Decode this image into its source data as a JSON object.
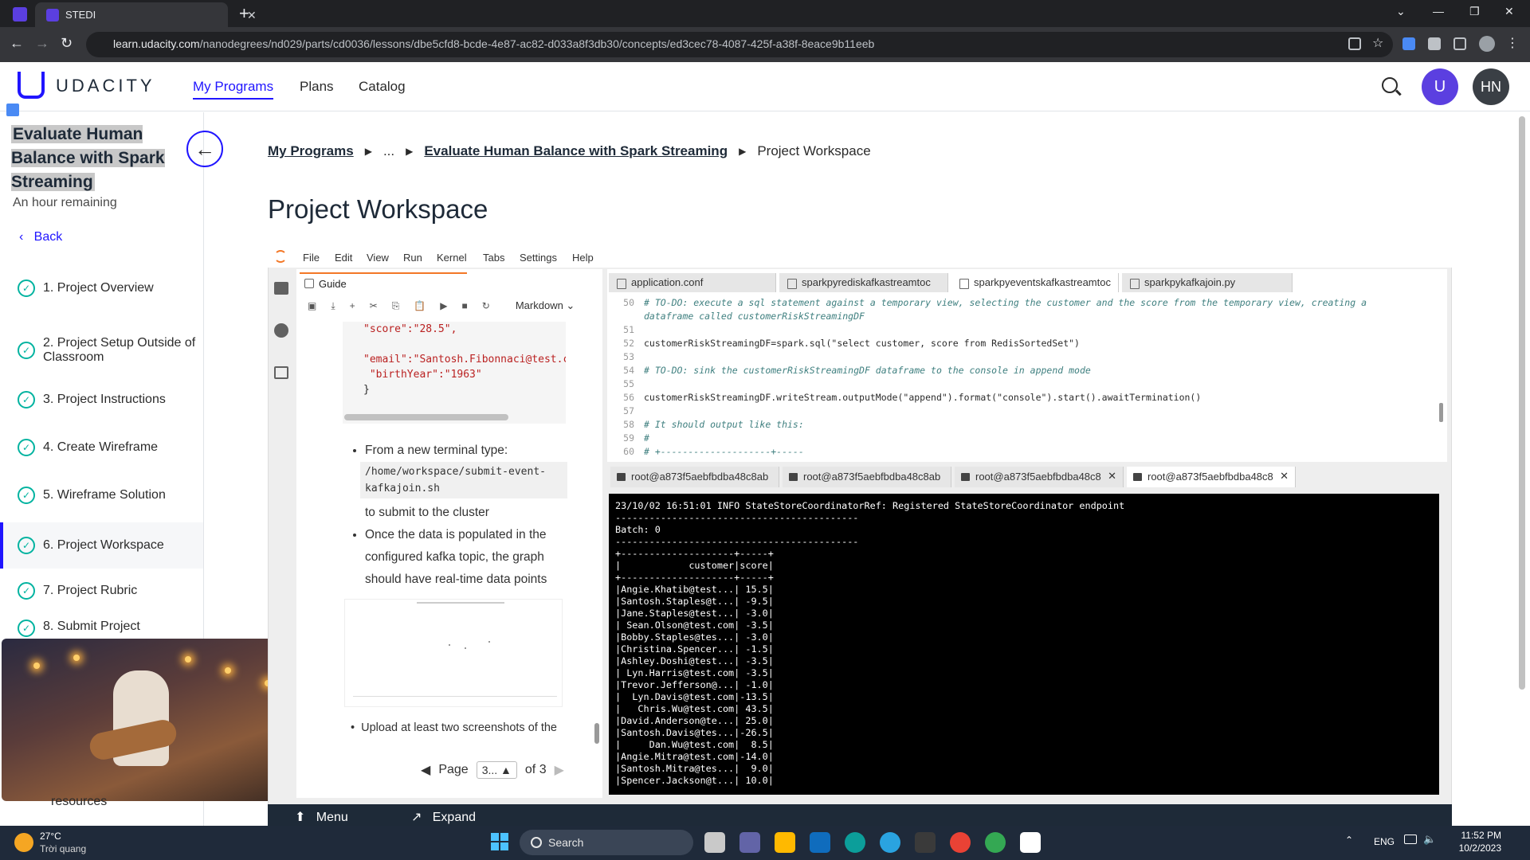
{
  "browser": {
    "tab_title": "STEDI",
    "url_domain": "learn.udacity.com",
    "url_path": "/nanodegrees/nd029/parts/cd0036/lessons/dbe5cfd8-bcde-4e87-ac82-d033a8f3db30/concepts/ed3cec78-4087-425f-a38f-8eace9b11eeb"
  },
  "header": {
    "logo_text": "UDACITY",
    "nav": [
      "My Programs",
      "Plans",
      "Catalog"
    ],
    "user_initials": "HN"
  },
  "sidebar": {
    "course_title": "Evaluate Human Balance with Spark Streaming",
    "time_remaining": "An hour remaining",
    "back_label": "Back",
    "lessons": [
      {
        "label": "1. Project Overview"
      },
      {
        "label": "2. Project Setup Outside of Classroom"
      },
      {
        "label": "3. Project Instructions"
      },
      {
        "label": "4. Create Wireframe"
      },
      {
        "label": "5. Wireframe Solution"
      },
      {
        "label": "6. Project Workspace"
      },
      {
        "label": "7. Project Rubric"
      },
      {
        "label": "8. Submit Project"
      }
    ],
    "resources_label": "resources"
  },
  "breadcrumb": {
    "items": [
      "My Programs",
      "...",
      "Evaluate Human Balance with Spark Streaming",
      "Project Workspace"
    ]
  },
  "page_title": "Project Workspace",
  "jupyter": {
    "menu": [
      "File",
      "Edit",
      "View",
      "Run",
      "Kernel",
      "Tabs",
      "Settings",
      "Help"
    ],
    "guide_tab": "Guide",
    "cell_type": "Markdown",
    "snippet_lines": [
      "\"score\":\"28.5\",",
      "",
      "\"email\":\"Santosh.Fibonnaci@test.c",
      " \"birthYear\":\"1963\"",
      "}"
    ],
    "bullet1_text": "From a new terminal type:",
    "bullet1_code": "/home/workspace/submit-event-kafkajoin.sh",
    "bullet1_after": "to submit to the cluster",
    "bullet2_text": "Once the data is populated in the configured kafka topic, the graph should have real-time data points",
    "bullet3_text": "Upload at least two screenshots of the",
    "pager": {
      "page_label": "Page",
      "page_value": "3...",
      "of_label": "of 3"
    },
    "editor_tabs": [
      "application.conf",
      "sparkpyrediskafkastreamtoc",
      "sparkpyeventskafkastreamtoc",
      "sparkpykafkajoin.py"
    ],
    "code_lines": [
      {
        "n": "50",
        "type": "comment",
        "text": "# TO-DO: execute a sql statement against a temporary view, selecting the customer and the score from the temporary view, creating a"
      },
      {
        "n": "",
        "type": "comment",
        "text": "dataframe called customerRiskStreamingDF"
      },
      {
        "n": "51",
        "type": "blank",
        "text": ""
      },
      {
        "n": "52",
        "type": "code1",
        "text": ""
      },
      {
        "n": "53",
        "type": "blank",
        "text": ""
      },
      {
        "n": "54",
        "type": "comment",
        "text": "# TO-DO: sink the customerRiskStreamingDF dataframe to the console in append mode"
      },
      {
        "n": "55",
        "type": "blank",
        "text": ""
      },
      {
        "n": "56",
        "type": "code2",
        "text": ""
      },
      {
        "n": "57",
        "type": "blank",
        "text": ""
      },
      {
        "n": "58",
        "type": "comment",
        "text": "# It should output like this:"
      },
      {
        "n": "59",
        "type": "comment",
        "text": "#"
      },
      {
        "n": "60",
        "type": "comment",
        "text": "# +--------------------+-----"
      }
    ],
    "code52": "customerRiskStreamingDF=spark.sql(\"select customer, score from RedisSortedSet\")",
    "code56": "customerRiskStreamingDF.writeStream.outputMode(\"append\").format(\"console\").start().awaitTermination()",
    "terminal_tabs": [
      "root@a873f5aebfbdba48c8ab",
      "root@a873f5aebfbdba48c8ab",
      "root@a873f5aebfbdba48c8",
      "root@a873f5aebfbdba48c8"
    ],
    "terminal_lines": [
      "23/10/02 16:51:01 INFO StateStoreCoordinatorRef: Registered StateStoreCoordinator endpoint",
      "-------------------------------------------",
      "Batch: 0",
      "-------------------------------------------",
      "+--------------------+-----+",
      "|            customer|score|",
      "+--------------------+-----+",
      "|Angie.Khatib@test...| 15.5|",
      "|Santosh.Staples@t...| -9.5|",
      "|Jane.Staples@test...| -3.0|",
      "| Sean.Olson@test.com| -3.5|",
      "|Bobby.Staples@tes...| -3.0|",
      "|Christina.Spencer...| -1.5|",
      "|Ashley.Doshi@test...| -3.5|",
      "| Lyn.Harris@test.com| -3.5|",
      "|Trevor.Jefferson@...| -1.0|",
      "|  Lyn.Davis@test.com|-13.5|",
      "|   Chris.Wu@test.com| 43.5|",
      "|David.Anderson@te...| 25.0|",
      "|Santosh.Davis@tes...|-26.5|",
      "|     Dan.Wu@test.com|  8.5|",
      "|Angie.Mitra@test.com|-14.0|",
      "|Santosh.Mitra@tes...|  9.0|",
      "|Spencer.Jackson@t...| 10.0|"
    ],
    "footer_menu": "Menu",
    "footer_expand": "Expand"
  },
  "taskbar": {
    "weather_temp": "27°C",
    "weather_desc": "Trời quang",
    "search_label": "Search",
    "lang": "ENG",
    "time": "11:52 PM",
    "date": "10/2/2023",
    "colors": {
      "bg": "#1f2a3a",
      "accent": "#4cc2ff"
    }
  },
  "colors": {
    "brand": "#2015ff",
    "check": "#02b3a0",
    "jupyter_orange": "#f37726"
  }
}
